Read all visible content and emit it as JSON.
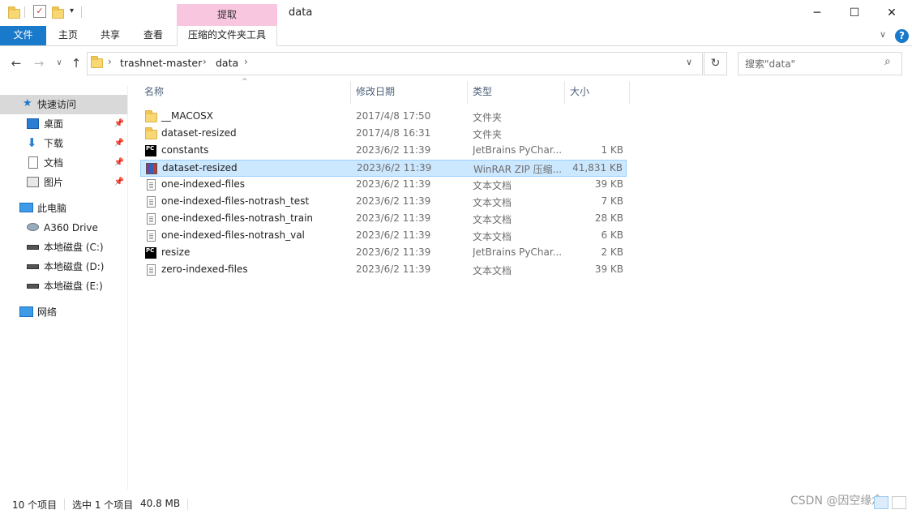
{
  "window": {
    "title": "data",
    "contextual_tab_header": "提取",
    "minimize_icon": "─",
    "maximize_icon": "☐",
    "close_icon": "✕"
  },
  "ribbon": {
    "tabs": [
      "文件",
      "主页",
      "共享",
      "查看",
      "压缩的文件夹工具"
    ],
    "accent_color": "#1979ca",
    "contextual_color": "#f9c6e0"
  },
  "address": {
    "crumbs": [
      "trashnet-master",
      "data"
    ],
    "search_placeholder": "搜索\"data\""
  },
  "navpane": {
    "quick_access": "快速访问",
    "quick_items": [
      "桌面",
      "下载",
      "文档",
      "图片"
    ],
    "this_pc": "此电脑",
    "pc_items": [
      "A360 Drive",
      "本地磁盘 (C:)",
      "本地磁盘 (D:)",
      "本地磁盘 (E:)"
    ],
    "network": "网络"
  },
  "columns": {
    "name": "名称",
    "date": "修改日期",
    "type": "类型",
    "size": "大小"
  },
  "files": [
    {
      "name": "__MACOSX",
      "date": "2017/4/8 17:50",
      "type": "文件夹",
      "size": "",
      "icon": "folder"
    },
    {
      "name": "dataset-resized",
      "date": "2017/4/8 16:31",
      "type": "文件夹",
      "size": "",
      "icon": "folder"
    },
    {
      "name": "constants",
      "date": "2023/6/2 11:39",
      "type": "JetBrains PyChar...",
      "size": "1 KB",
      "icon": "pycharm"
    },
    {
      "name": "dataset-resized",
      "date": "2023/6/2 11:39",
      "type": "WinRAR ZIP 压缩...",
      "size": "41,831 KB",
      "icon": "winrar"
    },
    {
      "name": "one-indexed-files",
      "date": "2023/6/2 11:39",
      "type": "文本文档",
      "size": "39 KB",
      "icon": "text"
    },
    {
      "name": "one-indexed-files-notrash_test",
      "date": "2023/6/2 11:39",
      "type": "文本文档",
      "size": "7 KB",
      "icon": "text"
    },
    {
      "name": "one-indexed-files-notrash_train",
      "date": "2023/6/2 11:39",
      "type": "文本文档",
      "size": "28 KB",
      "icon": "text"
    },
    {
      "name": "one-indexed-files-notrash_val",
      "date": "2023/6/2 11:39",
      "type": "文本文档",
      "size": "6 KB",
      "icon": "text"
    },
    {
      "name": "resize",
      "date": "2023/6/2 11:39",
      "type": "JetBrains PyChar...",
      "size": "2 KB",
      "icon": "pycharm"
    },
    {
      "name": "zero-indexed-files",
      "date": "2023/6/2 11:39",
      "type": "文本文档",
      "size": "39 KB",
      "icon": "text"
    }
  ],
  "status": {
    "item_count": "10 个项目",
    "selection": "选中 1 个项目",
    "selection_size": "40.8 MB",
    "watermark": "CSDN @因空缘念"
  }
}
